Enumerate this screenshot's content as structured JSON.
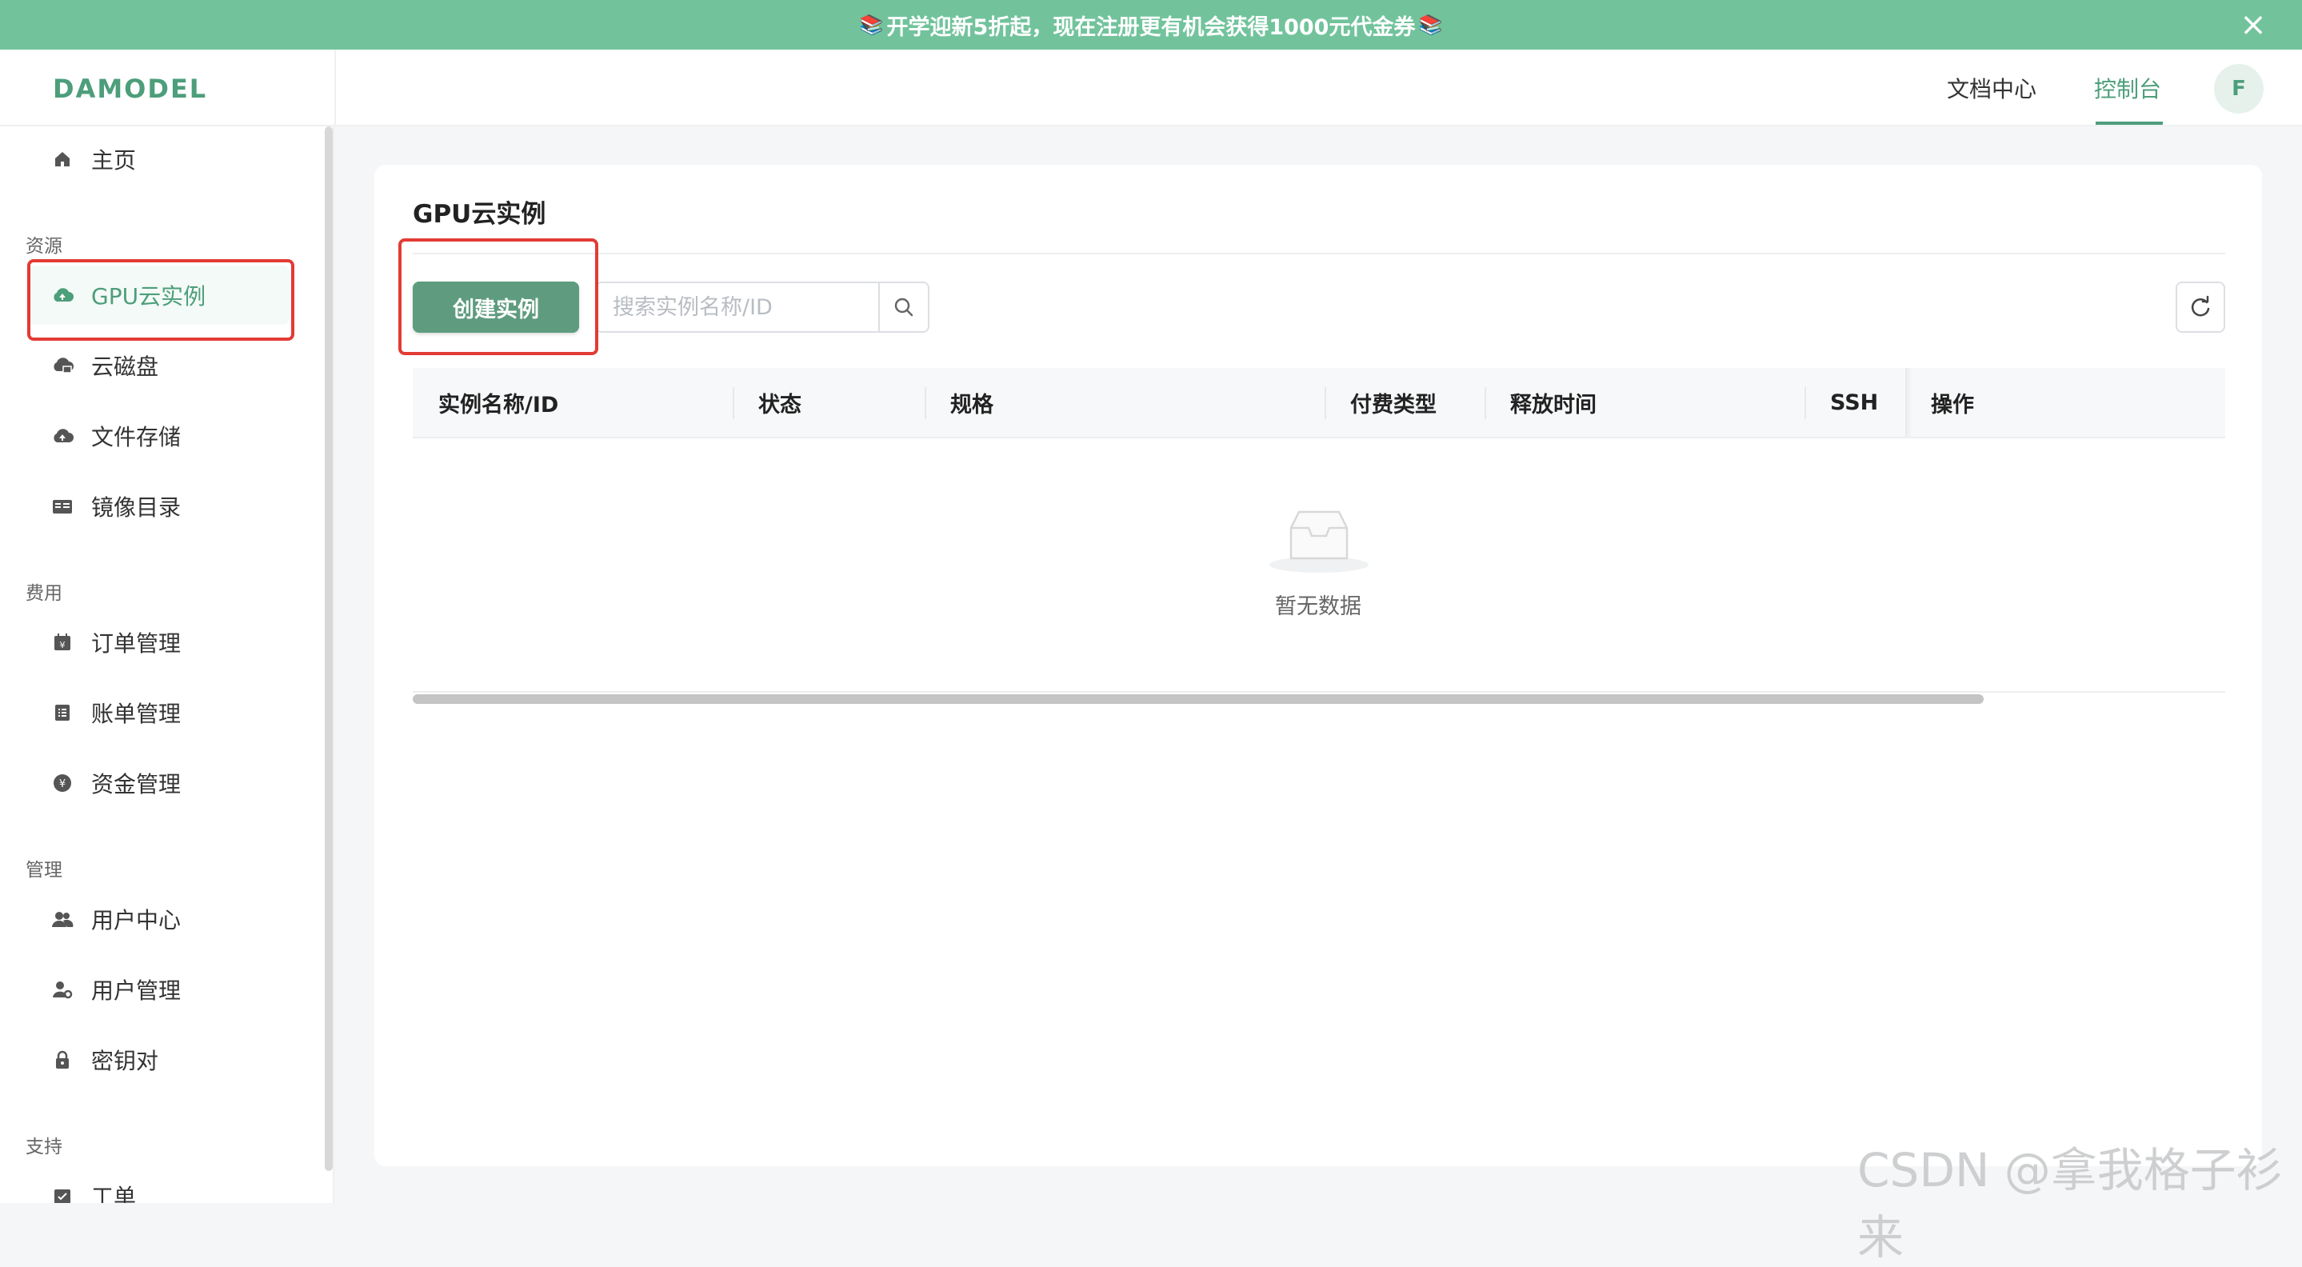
{
  "banner": {
    "text": "开学迎新5折起，现在注册更有机会获得1000元代金券",
    "close": "×"
  },
  "header": {
    "logo": "DAMODEL",
    "nav": [
      "文档中心",
      "控制台"
    ],
    "avatar": "F"
  },
  "sidebar": {
    "home": "主页",
    "groups": {
      "resources": "资源",
      "billing": "费用",
      "management": "管理",
      "support": "支持"
    },
    "items": [
      {
        "label": "GPU云实例",
        "icon": "cloud-icon"
      },
      {
        "label": "云磁盘",
        "icon": "cloud-disk-icon"
      },
      {
        "label": "文件存储",
        "icon": "cloud-upload-icon"
      },
      {
        "label": "镜像目录",
        "icon": "image-catalog-icon"
      },
      {
        "label": "订单管理",
        "icon": "order-icon"
      },
      {
        "label": "账单管理",
        "icon": "bill-icon"
      },
      {
        "label": "资金管理",
        "icon": "yen-coin-icon"
      },
      {
        "label": "用户中心",
        "icon": "users-icon"
      },
      {
        "label": "用户管理",
        "icon": "user-manage-icon"
      },
      {
        "label": "密钥对",
        "icon": "lock-icon"
      },
      {
        "label": "工单",
        "icon": "ticket-icon"
      }
    ],
    "active": "GPU云实例"
  },
  "main": {
    "title": "GPU云实例",
    "create_button": "创建实例",
    "search_placeholder": "搜索实例名称/ID",
    "columns": [
      "实例名称/ID",
      "状态",
      "规格",
      "付费类型",
      "释放时间",
      "SSH",
      "操作"
    ],
    "rows": [],
    "empty_text": "暂无数据"
  },
  "watermark": "CSDN @拿我格子衫来",
  "colors": {
    "accent": "#4d9e7b",
    "banner": "#72c39c",
    "button": "#5f9c7f",
    "highlight": "#e23b34"
  }
}
